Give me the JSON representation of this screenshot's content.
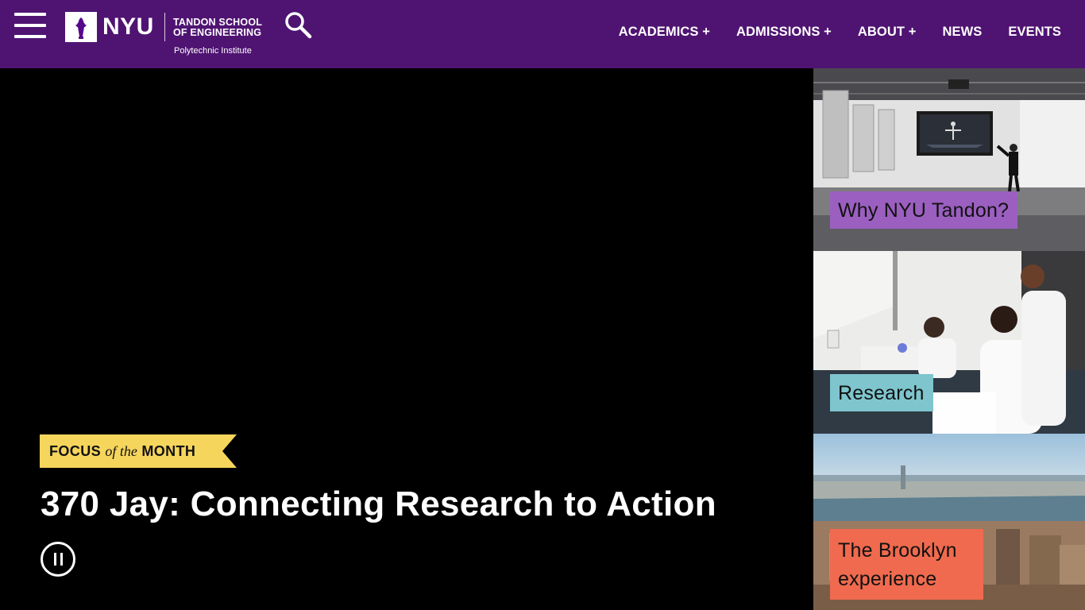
{
  "header": {
    "logo": {
      "nyu": "NYU",
      "school_line1": "TANDON SCHOOL",
      "school_line2": "OF ENGINEERING",
      "subtitle": "Polytechnic Institute"
    },
    "nav": [
      {
        "label": "ACADEMICS +"
      },
      {
        "label": "ADMISSIONS +"
      },
      {
        "label": "ABOUT +"
      },
      {
        "label": "NEWS"
      },
      {
        "label": "EVENTS"
      }
    ],
    "icons": {
      "menu": "hamburger-menu-icon",
      "search": "search-icon"
    }
  },
  "hero": {
    "ribbon": {
      "part1": "FOCUS",
      "part2": "of the",
      "part3": "MONTH"
    },
    "title": "370 Jay: Connecting Research to Action",
    "control_icon": "pause-icon"
  },
  "tiles": [
    {
      "label": "Why NYU Tandon?",
      "color": "#9b5fc0"
    },
    {
      "label": "Research",
      "color": "#7ec5ce"
    },
    {
      "label": "The Brooklyn experience",
      "color": "#ef6a4e"
    }
  ],
  "colors": {
    "brand_purple": "#4f1472",
    "ribbon_yellow": "#f6d55c"
  }
}
